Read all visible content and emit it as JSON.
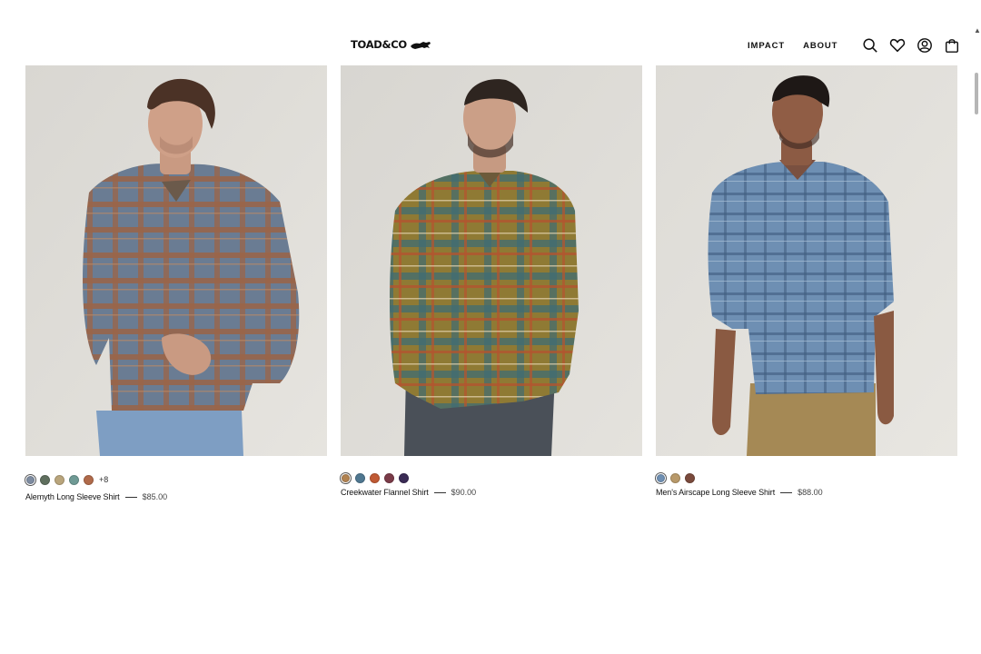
{
  "header": {
    "logo": "TOAD&CO",
    "nav": [
      "IMPACT",
      "ABOUT"
    ],
    "icons": [
      "search-icon",
      "heart-icon",
      "account-icon",
      "bag-icon"
    ]
  },
  "products": [
    {
      "name": "Alemyth Long Sleeve Shirt",
      "price": "$85.00",
      "swatches": [
        "#7d8ba0",
        "#5f6f5e",
        "#b9a57c",
        "#6f9a95",
        "#b06a4a"
      ],
      "selected_swatch": 0,
      "more_colors": "+8",
      "image": "man-in-blue-orange-plaid-shirt"
    },
    {
      "name": "Creekwater Flannel Shirt",
      "price": "$90.00",
      "swatches": [
        "#b18250",
        "#4f7790",
        "#c05a34",
        "#7a3b48",
        "#3a2b55"
      ],
      "selected_swatch": 0,
      "more_colors": "",
      "image": "man-in-olive-plaid-flannel-shirt"
    },
    {
      "name": "Men's Airscape Long Sleeve Shirt",
      "price": "$88.00",
      "swatches": [
        "#6e8fb3",
        "#b8996a",
        "#7a4a3c"
      ],
      "selected_swatch": 0,
      "more_colors": "",
      "image": "man-in-blue-check-shirt"
    }
  ],
  "colors": {
    "background": "#ffffff",
    "text": "#111111",
    "photo_backdrop": "#dcdad5"
  }
}
